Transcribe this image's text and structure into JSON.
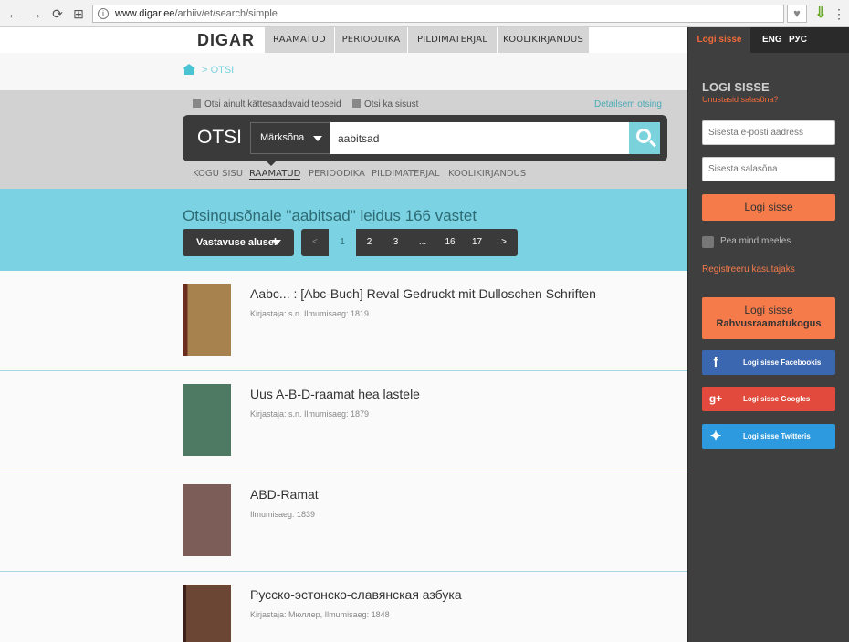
{
  "browser": {
    "url_host": "www.digar.ee",
    "url_path": "/arhiiv/et/search/simple"
  },
  "header": {
    "logo": "DIGAR",
    "tabs": [
      "RAAMATUD",
      "PERIOODIKA",
      "PILDIMATERJAL",
      "KOOLIKIRJANDUS"
    ]
  },
  "breadcrumb": {
    "separator": ">",
    "current": "OTSI"
  },
  "search": {
    "option_available": "Otsi ainult kättesaadavaid teoseid",
    "option_content": "Otsi ka sisust",
    "detail_link": "Detailsem otsing",
    "label": "OTSI",
    "field_select": "Märksõna",
    "query": "aabitsad",
    "categories": [
      "KOGU SISU",
      "RAAMATUD",
      "PERIOODIKA",
      "PILDIMATERJAL",
      "KOOLIKIRJANDUS"
    ]
  },
  "results_summary": {
    "title": "Otsingusõnale \"aabitsad\" leidus 166 vastet",
    "sort_label": "Vastavuse alusel",
    "pager": [
      "<",
      "1",
      "2",
      "3",
      "...",
      "16",
      "17",
      ">"
    ]
  },
  "results": [
    {
      "title": "Aabc... : [Abc-Buch] Reval Gedruckt mit Dulloschen Schriften",
      "meta": "Kirjastaja: s.n. Ilmumisaeg: 1819"
    },
    {
      "title": "Uus A-B-D-raamat hea lastele",
      "meta": "Kirjastaja: s.n. Ilmumisaeg: 1879"
    },
    {
      "title": "ABD-Ramat",
      "meta": "Ilmumisaeg: 1839"
    },
    {
      "title": "Русско-эстонско-славянская азбука",
      "meta": "Kirjastaja: Мюллер, Ilmumisaeg: 1848"
    }
  ],
  "sidebar": {
    "login_tab": "Logi sisse",
    "lang_eng": "ENG",
    "lang_rus": "РУС",
    "title": "LOGI SISSE",
    "forgot": "Unustasid salasõna?",
    "email_placeholder": "Sisesta e-posti aadress",
    "password_placeholder": "Sisesta salasõna",
    "login_button": "Logi sisse",
    "remember": "Pea mind meeles",
    "register": "Registreeru kasutajaks",
    "library_login_line1": "Logi sisse",
    "library_login_line2": "Rahvusraamatukogus",
    "facebook": "Logi sisse Facebookis",
    "google": "Logi sisse Googles",
    "twitter": "Logi sisse Twitteris"
  },
  "colors": {
    "accent": "#7ad2e2",
    "orange": "#f57b4b",
    "facebook": "#3b67b0",
    "google": "#e14a3c",
    "twitter": "#2d9ae0"
  }
}
